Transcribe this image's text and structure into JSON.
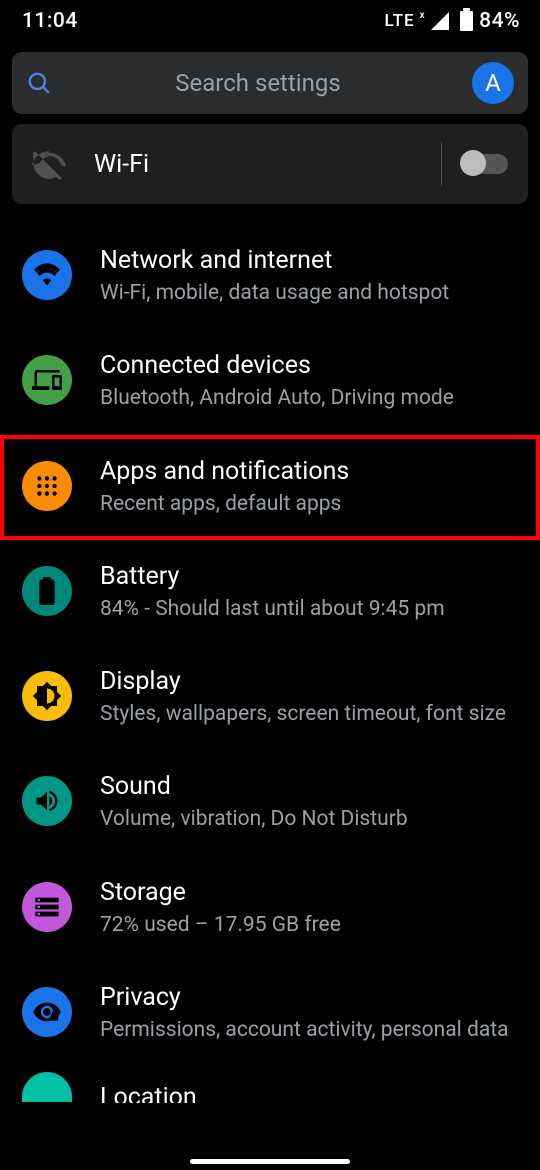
{
  "status_bar": {
    "time": "11:04",
    "network_type": "LTE",
    "battery_text": "84%"
  },
  "search": {
    "placeholder": "Search settings",
    "avatar_letter": "A"
  },
  "wifi_tile": {
    "label": "Wi-Fi",
    "enabled": false
  },
  "settings": [
    {
      "id": "network",
      "title": "Network and internet",
      "subtitle": "Wi-Fi, mobile, data usage and hotspot",
      "icon": "wifi",
      "color": "blue",
      "highlighted": false
    },
    {
      "id": "connected",
      "title": "Connected devices",
      "subtitle": "Bluetooth, Android Auto, Driving mode",
      "icon": "devices",
      "color": "green",
      "highlighted": false
    },
    {
      "id": "apps",
      "title": "Apps and notifications",
      "subtitle": "Recent apps, default apps",
      "icon": "apps",
      "color": "orange",
      "highlighted": true
    },
    {
      "id": "battery",
      "title": "Battery",
      "subtitle": "84% - Should last until about 9:45 pm",
      "icon": "battery",
      "color": "teal",
      "highlighted": false
    },
    {
      "id": "display",
      "title": "Display",
      "subtitle": "Styles, wallpapers, screen timeout, font size",
      "icon": "brightness",
      "color": "gold",
      "highlighted": false
    },
    {
      "id": "sound",
      "title": "Sound",
      "subtitle": "Volume, vibration, Do Not Disturb",
      "icon": "volume",
      "color": "dteal",
      "highlighted": false
    },
    {
      "id": "storage",
      "title": "Storage",
      "subtitle": "72% used – 17.95 GB free",
      "icon": "storage",
      "color": "purple",
      "highlighted": false
    },
    {
      "id": "privacy",
      "title": "Privacy",
      "subtitle": "Permissions, account activity, personal data",
      "icon": "privacy",
      "color": "lblue",
      "highlighted": false
    }
  ],
  "cutoff_item": {
    "title_fragment": "Location"
  }
}
